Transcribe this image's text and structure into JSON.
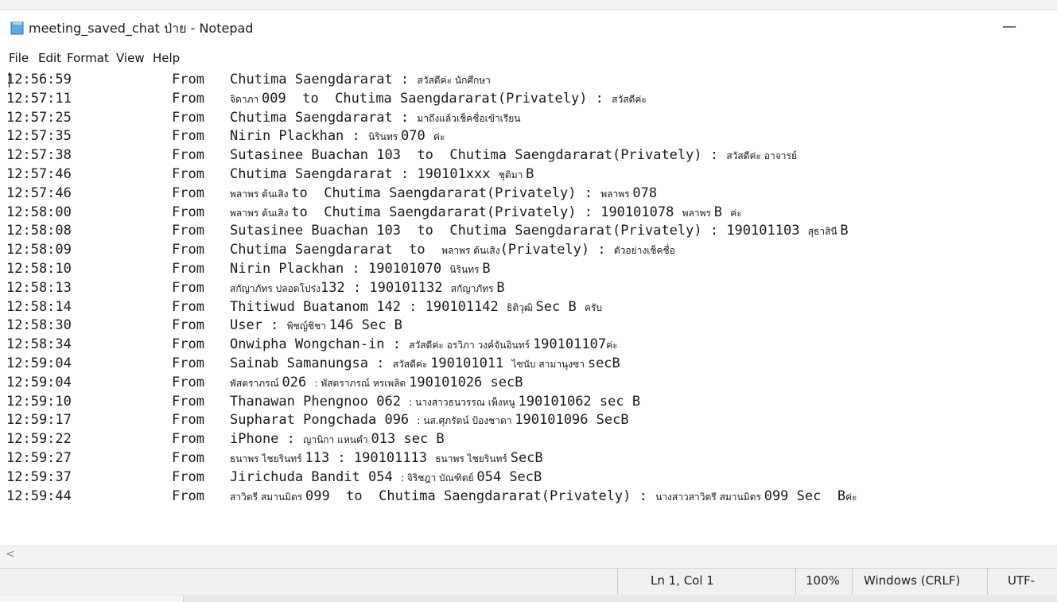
{
  "window": {
    "title": "meeting_saved_chat ป่าย - Notepad",
    "minimize_glyph": "—"
  },
  "menu": [
    "File",
    "Edit",
    "Format",
    "View",
    "Help"
  ],
  "lines": [
    {
      "time": "12:56:59",
      "from": "From",
      "parts": [
        {
          "t": "Chutima Saengdararat : "
        },
        {
          "t": "สวัสดีค่ะ นักศึกษา",
          "th": true
        }
      ]
    },
    {
      "time": "12:57:11",
      "from": "From",
      "parts": [
        {
          "t": "จิดาภา ",
          "th": true
        },
        {
          "t": "009  to  Chutima Saengdararat(Privately) : "
        },
        {
          "t": "สวัสดีค่ะ",
          "th": true
        }
      ]
    },
    {
      "time": "12:57:25",
      "from": "From",
      "parts": [
        {
          "t": "Chutima Saengdararat : "
        },
        {
          "t": "มาถึงแล้วเช็คชื่อเข้าเรียน",
          "th": true
        }
      ]
    },
    {
      "time": "12:57:35",
      "from": "From",
      "parts": [
        {
          "t": "Nirin Plackhan : "
        },
        {
          "t": "นิรินทร ",
          "th": true
        },
        {
          "t": "070 "
        },
        {
          "t": "ค่ะ",
          "th": true
        }
      ]
    },
    {
      "time": "12:57:38",
      "from": "From",
      "parts": [
        {
          "t": "Sutasinee Buachan 103  to  Chutima Saengdararat(Privately) : "
        },
        {
          "t": "สวัสดีค่ะ อาจารย์",
          "th": true
        }
      ]
    },
    {
      "time": "12:57:46",
      "from": "From",
      "parts": [
        {
          "t": "Chutima Saengdararat : 190101xxx "
        },
        {
          "t": "ชุติมา ",
          "th": true
        },
        {
          "t": "B"
        }
      ]
    },
    {
      "time": "12:57:46",
      "from": "From",
      "parts": [
        {
          "t": "พลาพร ต้นเสิง ",
          "th": true
        },
        {
          "t": "to  Chutima Saengdararat(Privately) : "
        },
        {
          "t": "พลาพร ",
          "th": true
        },
        {
          "t": "078"
        }
      ]
    },
    {
      "time": "12:58:00",
      "from": "From",
      "parts": [
        {
          "t": "พลาพร ต้นเสิง ",
          "th": true
        },
        {
          "t": "to  Chutima Saengdararat(Privately) : 190101078 "
        },
        {
          "t": "พลาพร ",
          "th": true
        },
        {
          "t": "B "
        },
        {
          "t": "ค่ะ",
          "th": true
        }
      ]
    },
    {
      "time": "12:58:08",
      "from": "From",
      "parts": [
        {
          "t": "Sutasinee Buachan 103  to  Chutima Saengdararat(Privately) : 190101103 "
        },
        {
          "t": "สุธาสินี ",
          "th": true
        },
        {
          "t": "B"
        }
      ]
    },
    {
      "time": "12:58:09",
      "from": "From",
      "parts": [
        {
          "t": "Chutima Saengdararat  to  "
        },
        {
          "t": "พลาพร ต้นเสิง",
          "th": true
        },
        {
          "t": "(Privately) : "
        },
        {
          "t": "ตัวอย่างเช็คชื่อ",
          "th": true
        }
      ]
    },
    {
      "time": "12:58:10",
      "from": "From",
      "parts": [
        {
          "t": "Nirin Plackhan : 190101070 "
        },
        {
          "t": "นิรินทร ",
          "th": true
        },
        {
          "t": "B"
        }
      ]
    },
    {
      "time": "12:58:13",
      "from": "From",
      "parts": [
        {
          "t": "สกัญาภัทร ปลอดโปร่ง",
          "th": true
        },
        {
          "t": "132 : 190101132 "
        },
        {
          "t": "สกัญาภัทร ",
          "th": true
        },
        {
          "t": "B"
        }
      ]
    },
    {
      "time": "12:58:14",
      "from": "From",
      "parts": [
        {
          "t": "Thitiwud Buatanom 142 : 190101142 "
        },
        {
          "t": "ธิติวุฒิ ",
          "th": true
        },
        {
          "t": "Sec B "
        },
        {
          "t": "ครับ",
          "th": true
        }
      ]
    },
    {
      "time": "12:58:30",
      "from": "From",
      "parts": [
        {
          "t": "User : "
        },
        {
          "t": "พิชญ์ชิชา ",
          "th": true
        },
        {
          "t": "146 Sec B"
        }
      ]
    },
    {
      "time": "12:58:34",
      "from": "From",
      "parts": [
        {
          "t": "Onwipha Wongchan-in : "
        },
        {
          "t": "สวัสดีค่ะ อรวิภา วงค์จันอินทร์ ",
          "th": true
        },
        {
          "t": "190101107"
        },
        {
          "t": "ค่ะ",
          "th": true
        }
      ]
    },
    {
      "time": "12:59:04",
      "from": "From",
      "parts": [
        {
          "t": "Sainab Samanungsa : "
        },
        {
          "t": "สวัสดีค่ะ ",
          "th": true
        },
        {
          "t": "190101011 "
        },
        {
          "t": "ไซนับ สามานุงซา ",
          "th": true
        },
        {
          "t": "secB"
        }
      ]
    },
    {
      "time": "12:59:04",
      "from": "From",
      "parts": [
        {
          "t": "พัสตราภรณ์ ",
          "th": true
        },
        {
          "t": "026 "
        },
        {
          "t": ": พัสตราภรณ์ หรเพลิด ",
          "th": true
        },
        {
          "t": "190101026 secB"
        }
      ]
    },
    {
      "time": "12:59:10",
      "from": "From",
      "parts": [
        {
          "t": "Thanawan Phengnoo 062 "
        },
        {
          "t": ": นางสาวธนวรรณ เพ็งหนู ",
          "th": true
        },
        {
          "t": "190101062 sec B"
        }
      ]
    },
    {
      "time": "12:59:17",
      "from": "From",
      "parts": [
        {
          "t": "Supharat Pongchada 096 "
        },
        {
          "t": ": นส.ศุภรัตน์ ป้องชาดา ",
          "th": true
        },
        {
          "t": "190101096 SecB"
        }
      ]
    },
    {
      "time": "12:59:22",
      "from": "From",
      "parts": [
        {
          "t": "iPhone : "
        },
        {
          "t": "ญานิกา แหนคำ ",
          "th": true
        },
        {
          "t": "013 sec B"
        }
      ]
    },
    {
      "time": "12:59:27",
      "from": "From",
      "parts": [
        {
          "t": "ธนาพร ไชยรินทร์ ",
          "th": true
        },
        {
          "t": "113 : 190101113 "
        },
        {
          "t": "ธนาพร ไชยรินทร์ ",
          "th": true
        },
        {
          "t": "SecB"
        }
      ]
    },
    {
      "time": "12:59:37",
      "from": "From",
      "parts": [
        {
          "t": "Jirichuda Bandit 054 "
        },
        {
          "t": ": จิริชฎา บัณฑิตย์ ",
          "th": true
        },
        {
          "t": "054 SecB"
        }
      ]
    },
    {
      "time": "12:59:44",
      "from": "From",
      "parts": [
        {
          "t": "สาวิตรี สมานมิตร ",
          "th": true
        },
        {
          "t": "099  to  Chutima Saengdararat(Privately) : "
        },
        {
          "t": "นางสาวสาวิตรี สมานมิตร ",
          "th": true
        },
        {
          "t": "099 Sec  B"
        },
        {
          "t": "ค่ะ",
          "th": true
        }
      ]
    }
  ],
  "hscroll": {
    "left_arrow": "<"
  },
  "status": {
    "position": "Ln 1, Col 1",
    "zoom": "100%",
    "line_ending": "Windows (CRLF)",
    "encoding": "UTF-"
  }
}
